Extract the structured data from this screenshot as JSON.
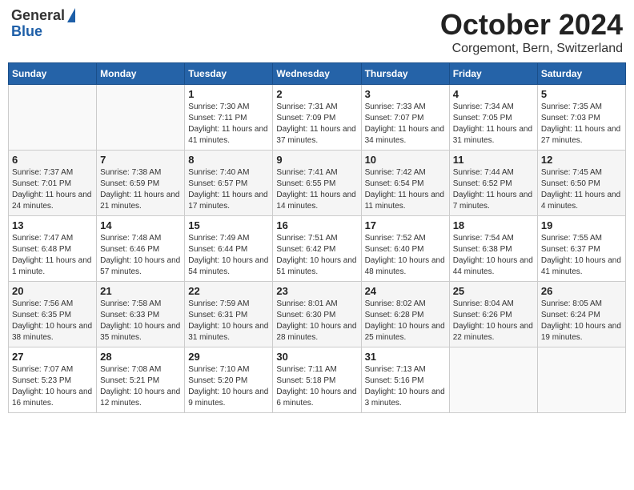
{
  "header": {
    "logo": {
      "line1": "General",
      "line2": "Blue"
    },
    "title": "October 2024",
    "location": "Corgemont, Bern, Switzerland"
  },
  "weekdays": [
    "Sunday",
    "Monday",
    "Tuesday",
    "Wednesday",
    "Thursday",
    "Friday",
    "Saturday"
  ],
  "weeks": [
    [
      {
        "day": "",
        "info": ""
      },
      {
        "day": "",
        "info": ""
      },
      {
        "day": "1",
        "info": "Sunrise: 7:30 AM\nSunset: 7:11 PM\nDaylight: 11 hours and 41 minutes."
      },
      {
        "day": "2",
        "info": "Sunrise: 7:31 AM\nSunset: 7:09 PM\nDaylight: 11 hours and 37 minutes."
      },
      {
        "day": "3",
        "info": "Sunrise: 7:33 AM\nSunset: 7:07 PM\nDaylight: 11 hours and 34 minutes."
      },
      {
        "day": "4",
        "info": "Sunrise: 7:34 AM\nSunset: 7:05 PM\nDaylight: 11 hours and 31 minutes."
      },
      {
        "day": "5",
        "info": "Sunrise: 7:35 AM\nSunset: 7:03 PM\nDaylight: 11 hours and 27 minutes."
      }
    ],
    [
      {
        "day": "6",
        "info": "Sunrise: 7:37 AM\nSunset: 7:01 PM\nDaylight: 11 hours and 24 minutes."
      },
      {
        "day": "7",
        "info": "Sunrise: 7:38 AM\nSunset: 6:59 PM\nDaylight: 11 hours and 21 minutes."
      },
      {
        "day": "8",
        "info": "Sunrise: 7:40 AM\nSunset: 6:57 PM\nDaylight: 11 hours and 17 minutes."
      },
      {
        "day": "9",
        "info": "Sunrise: 7:41 AM\nSunset: 6:55 PM\nDaylight: 11 hours and 14 minutes."
      },
      {
        "day": "10",
        "info": "Sunrise: 7:42 AM\nSunset: 6:54 PM\nDaylight: 11 hours and 11 minutes."
      },
      {
        "day": "11",
        "info": "Sunrise: 7:44 AM\nSunset: 6:52 PM\nDaylight: 11 hours and 7 minutes."
      },
      {
        "day": "12",
        "info": "Sunrise: 7:45 AM\nSunset: 6:50 PM\nDaylight: 11 hours and 4 minutes."
      }
    ],
    [
      {
        "day": "13",
        "info": "Sunrise: 7:47 AM\nSunset: 6:48 PM\nDaylight: 11 hours and 1 minute."
      },
      {
        "day": "14",
        "info": "Sunrise: 7:48 AM\nSunset: 6:46 PM\nDaylight: 10 hours and 57 minutes."
      },
      {
        "day": "15",
        "info": "Sunrise: 7:49 AM\nSunset: 6:44 PM\nDaylight: 10 hours and 54 minutes."
      },
      {
        "day": "16",
        "info": "Sunrise: 7:51 AM\nSunset: 6:42 PM\nDaylight: 10 hours and 51 minutes."
      },
      {
        "day": "17",
        "info": "Sunrise: 7:52 AM\nSunset: 6:40 PM\nDaylight: 10 hours and 48 minutes."
      },
      {
        "day": "18",
        "info": "Sunrise: 7:54 AM\nSunset: 6:38 PM\nDaylight: 10 hours and 44 minutes."
      },
      {
        "day": "19",
        "info": "Sunrise: 7:55 AM\nSunset: 6:37 PM\nDaylight: 10 hours and 41 minutes."
      }
    ],
    [
      {
        "day": "20",
        "info": "Sunrise: 7:56 AM\nSunset: 6:35 PM\nDaylight: 10 hours and 38 minutes."
      },
      {
        "day": "21",
        "info": "Sunrise: 7:58 AM\nSunset: 6:33 PM\nDaylight: 10 hours and 35 minutes."
      },
      {
        "day": "22",
        "info": "Sunrise: 7:59 AM\nSunset: 6:31 PM\nDaylight: 10 hours and 31 minutes."
      },
      {
        "day": "23",
        "info": "Sunrise: 8:01 AM\nSunset: 6:30 PM\nDaylight: 10 hours and 28 minutes."
      },
      {
        "day": "24",
        "info": "Sunrise: 8:02 AM\nSunset: 6:28 PM\nDaylight: 10 hours and 25 minutes."
      },
      {
        "day": "25",
        "info": "Sunrise: 8:04 AM\nSunset: 6:26 PM\nDaylight: 10 hours and 22 minutes."
      },
      {
        "day": "26",
        "info": "Sunrise: 8:05 AM\nSunset: 6:24 PM\nDaylight: 10 hours and 19 minutes."
      }
    ],
    [
      {
        "day": "27",
        "info": "Sunrise: 7:07 AM\nSunset: 5:23 PM\nDaylight: 10 hours and 16 minutes."
      },
      {
        "day": "28",
        "info": "Sunrise: 7:08 AM\nSunset: 5:21 PM\nDaylight: 10 hours and 12 minutes."
      },
      {
        "day": "29",
        "info": "Sunrise: 7:10 AM\nSunset: 5:20 PM\nDaylight: 10 hours and 9 minutes."
      },
      {
        "day": "30",
        "info": "Sunrise: 7:11 AM\nSunset: 5:18 PM\nDaylight: 10 hours and 6 minutes."
      },
      {
        "day": "31",
        "info": "Sunrise: 7:13 AM\nSunset: 5:16 PM\nDaylight: 10 hours and 3 minutes."
      },
      {
        "day": "",
        "info": ""
      },
      {
        "day": "",
        "info": ""
      }
    ]
  ]
}
